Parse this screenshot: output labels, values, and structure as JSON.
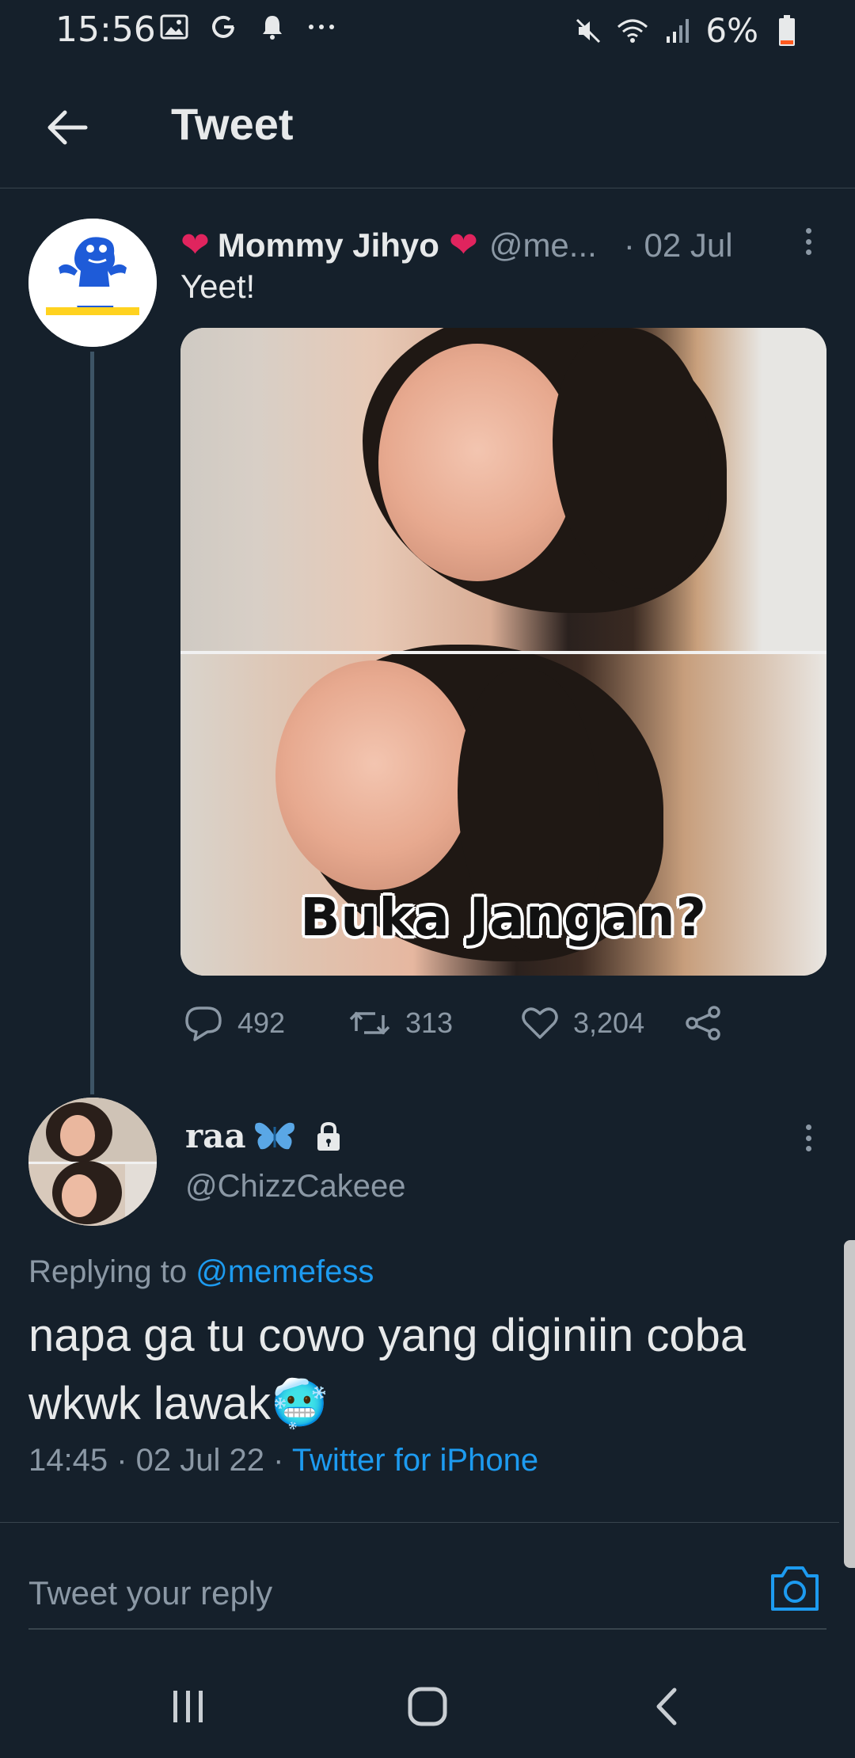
{
  "status_bar": {
    "time": "15:56",
    "battery": "6%",
    "left_icons": [
      "gallery-icon",
      "google-icon",
      "notification-bell-icon",
      "more-icon"
    ],
    "right_icons": [
      "mute-icon",
      "wifi-icon",
      "signal-icon",
      "battery-icon"
    ]
  },
  "header": {
    "title": "Tweet"
  },
  "tweet": {
    "author_name": "Mommy Jihyo",
    "handle": "@me...",
    "date": "· 02 Jul",
    "text": "Yeet!",
    "avatar_label": "MEMEFESS",
    "media_caption": "Buka Jangan?",
    "stats": {
      "replies": "492",
      "retweets": "313",
      "likes": "3,204"
    }
  },
  "reply": {
    "author_name": "raa",
    "handle": "@ChizzCakeee",
    "replying_to_label": "Replying to ",
    "replying_to_handle": "@memefess",
    "text": "napa ga tu cowo yang diginiin coba wkwk lawak",
    "emoji": "🥶",
    "meta": "14:45 · 02 Jul 22 · ",
    "source": "Twitter for iPhone"
  },
  "composer": {
    "placeholder": "Tweet your reply"
  },
  "colors": {
    "background": "#15202b",
    "accent": "#1d9bf0",
    "muted": "#8b98a5",
    "heart": "#e0245e"
  }
}
